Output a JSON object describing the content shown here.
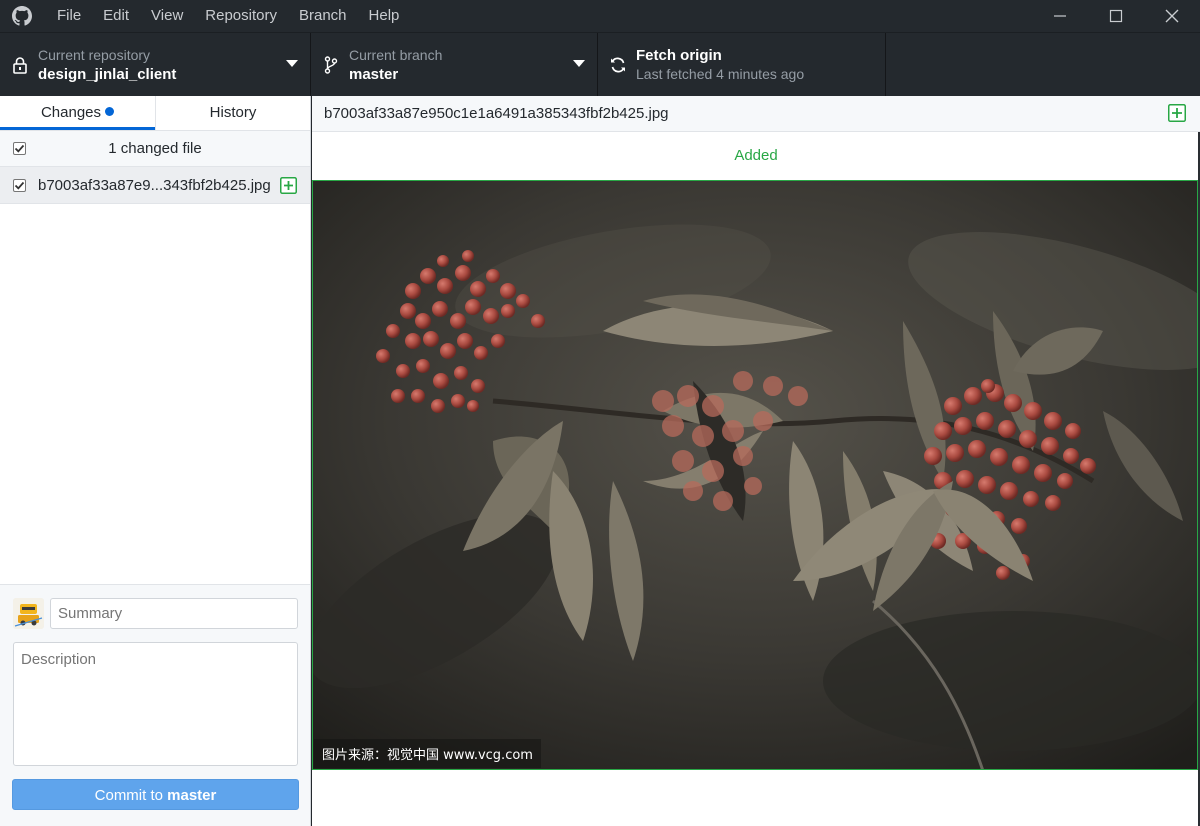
{
  "menu": [
    "File",
    "Edit",
    "View",
    "Repository",
    "Branch",
    "Help"
  ],
  "toolbar": {
    "repo_caption": "Current repository",
    "repo_name": "design_jinlai_client",
    "branch_caption": "Current branch",
    "branch_name": "master",
    "fetch_title": "Fetch origin",
    "fetch_sub": "Last fetched 4 minutes ago"
  },
  "tabs": {
    "changes": "Changes",
    "history": "History"
  },
  "changes": {
    "header": "1 changed file",
    "files": [
      {
        "name": "b7003af33a87e9...343fbf2b425.jpg"
      }
    ]
  },
  "commit": {
    "summary_placeholder": "Summary",
    "description_placeholder": "Description",
    "button_prefix": "Commit to ",
    "button_branch": "master"
  },
  "diff": {
    "file_path": "b7003af33a87e950c1e1a6491a385343fbf2b425.jpg",
    "status": "Added",
    "watermark": "图片来源：视觉中国 www.vcg.com"
  },
  "colors": {
    "accent": "#0366d6",
    "added": "#28a745",
    "commit_button": "#5fa4ec",
    "toolbar": "#24292e"
  },
  "icons": [
    "github-logo-icon",
    "minimize-icon",
    "maximize-icon",
    "close-icon",
    "lock-icon",
    "branch-icon",
    "sync-icon",
    "caret-down-icon",
    "checkbox-icon",
    "file-added-icon",
    "avatar-icon"
  ]
}
